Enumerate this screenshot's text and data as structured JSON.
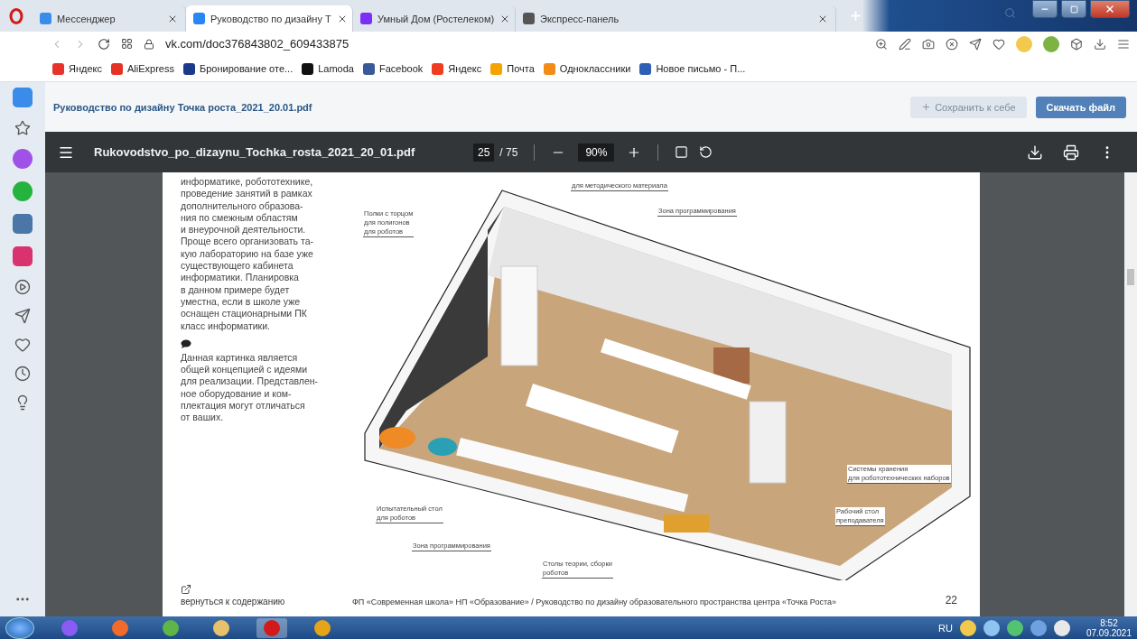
{
  "browser": {
    "tabs": [
      {
        "title": "Мессенджер",
        "selected": false,
        "color": "#3b8bea"
      },
      {
        "title": "Руководство по дизайну Т",
        "selected": true,
        "color": "#2787f5"
      },
      {
        "title": "Умный Дом (Ростелеком)",
        "selected": false,
        "color": "#7b2ff7"
      },
      {
        "title": "Экспресс-панель",
        "selected": false,
        "color": "#555555"
      }
    ],
    "address": "vk.com/doc376843802_609433875",
    "bookmarks": [
      {
        "label": "Яндекс",
        "color": "#e8322c"
      },
      {
        "label": "AliExpress",
        "color": "#e43225"
      },
      {
        "label": "Бронирование оте...",
        "color": "#1b3a8c"
      },
      {
        "label": "Lamoda",
        "color": "#111111"
      },
      {
        "label": "Facebook",
        "color": "#3b5998"
      },
      {
        "label": "Яндекс",
        "color": "#f23c1f"
      },
      {
        "label": "Почта",
        "color": "#f5a300"
      },
      {
        "label": "Одноклассники",
        "color": "#f28b17"
      },
      {
        "label": "Новое письмо - П...",
        "color": "#2d5fb4"
      }
    ]
  },
  "vk_header": {
    "title": "Руководство по дизайну Точка роста_2021_20.01.pdf",
    "buttons": [
      {
        "label": "Сохранить к себе",
        "kind": "secondary"
      },
      {
        "label": "Скачать файл",
        "kind": "primary"
      }
    ]
  },
  "pdf_toolbar": {
    "filename": "Rukovodstvo_po_dizaynu_Tochka_rosta_2021_20_01.pdf",
    "page": "25",
    "total": "/ 75",
    "zoom": "90%"
  },
  "page": {
    "paragraph": "информатике, робототехнике,\nпроведение занятий в рамках\nдополнительного образова-\nния по смежным областям\nи внеурочной деятельности.\nПроще всего организовать та-\nкую лабораторию на базе уже\nсуществующего кабинета\nинформатики. Планировка\nв данном примере будет\nуместна, если в школе уже\nоснащен стационарными ПК\nкласс информатики.",
    "note": "Данная картинка является\nобщей концепцией с идеями\nдля реализации. Представлен-\nное оборудование и ком-\nплектация могут отличаться\nот ваших.",
    "figure_labels": [
      "для методического материала",
      "Зона программирования",
      "Полки с торцом\nдля полигонов\nдля роботов",
      "Системы хранения\nдля робототехнических наборов",
      "Испытательный стол\nдля роботов",
      "Рабочий стол\nпреподавателя",
      "Зона программирования",
      "Столы теории, сборки\nроботов"
    ],
    "back_link": "вернуться к содержанию",
    "caption": "ФП «Современная школа» НП «Образование» / Руководство по дизайну образовательного пространства центра «Точка Роста»",
    "page_number": "22"
  },
  "taskbar": {
    "language": "RU",
    "time": "8:52",
    "date": "07.09.2021"
  }
}
